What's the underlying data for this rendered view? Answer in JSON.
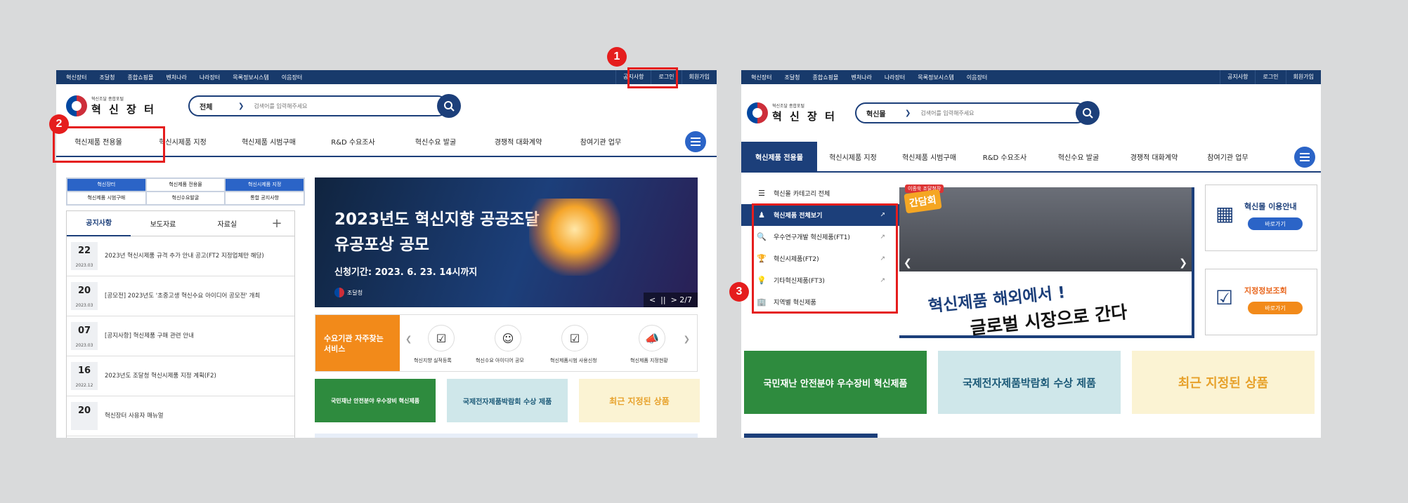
{
  "left": {
    "util_left": [
      "혁신장터",
      "조달청",
      "종합쇼핑몰",
      "벤처나라",
      "나라장터",
      "목록정보시스템",
      "이음장터"
    ],
    "util_right": [
      "공지사항",
      "로그인",
      "회원가입"
    ],
    "logo_small": "혁신조달 종합포털",
    "logo_big": "혁 신 장 터",
    "search_select": "전체",
    "search_placeholder": "검색어를 입력해주세요",
    "gnb": [
      "혁신제품 전용몰",
      "혁신시제품 지정",
      "혁신제품 시범구매",
      "R&D 수요조사",
      "혁신수요 발굴",
      "경쟁적 대화계약",
      "참여기관 업무"
    ],
    "tabgrid": [
      "혁신장터",
      "혁신제품 전용몰",
      "혁신시제품 지정",
      "혁신제품 시범구매",
      "혁신수요발굴",
      "통합 공지사항"
    ],
    "notice_tabs": [
      "공지사항",
      "보도자료",
      "자료실"
    ],
    "notice_plus": "+",
    "notices": [
      {
        "day": "22",
        "ym": "2023.03",
        "text": "2023년 혁신시제품 규격 추가 안내 공고(FT2 지정업체만 해당)"
      },
      {
        "day": "20",
        "ym": "2023.03",
        "text": "[공모전] 2023년도 '초중고생 혁신수요 아이디어 공모전' 개최"
      },
      {
        "day": "07",
        "ym": "2023.03",
        "text": "[공지사항] 혁신제품 구매 관련 안내"
      },
      {
        "day": "16",
        "ym": "2022.12",
        "text": "2023년도 조달청 혁신시제품 지정 계획(F2)"
      },
      {
        "day": "20",
        "ym": "",
        "text": "혁신장터 사용자 매뉴얼"
      }
    ],
    "banner_line1": "2023년도 혁신지향 공공조달",
    "banner_line2": "유공포상 공모",
    "banner_date": "신청기간: 2023. 6. 23. 14시까지",
    "banner_org": "조달청",
    "banner_page": "2/7",
    "service_label": "수요기관 자주찾는 서비스",
    "service_items": [
      "혁신지향 실적등록",
      "혁신수요 아이디어 공모",
      "혁신제품시범 사용신청",
      "혁신제품 지정현황"
    ],
    "promo1": "국민재난 안전분야 우수장비 혁신제품",
    "promo2": "국제전자제품박람회 수상 제품",
    "promo3": "최근 지정된 상품"
  },
  "right": {
    "util_left": [
      "혁신장터",
      "조달청",
      "종합쇼핑몰",
      "벤처나라",
      "나라장터",
      "목록정보시스템",
      "이음장터"
    ],
    "util_right": [
      "공지사항",
      "로그인",
      "회원가입"
    ],
    "logo_small": "혁신조달 종합포털",
    "logo_big": "혁 신 장 터",
    "search_select": "혁신몰",
    "search_placeholder": "검색어를 입력해주세요",
    "gnb": [
      "혁신제품 전용몰",
      "혁신시제품 지정",
      "혁신제품 시범구매",
      "R&D 수요조사",
      "혁신수요 발굴",
      "경쟁적 대화계약",
      "참여기관 업무"
    ],
    "categories": [
      {
        "label": "혁신몰 카테고리 전체",
        "icon": "☰"
      },
      {
        "label": "혁신제품 전체보기",
        "icon": "♟"
      },
      {
        "label": "우수연구개발 혁신제품(FT1)",
        "icon": "🔍"
      },
      {
        "label": "혁신시제품(FT2)",
        "icon": "🏆"
      },
      {
        "label": "기타혁신제품(FT3)",
        "icon": "💡"
      },
      {
        "label": "지역별 혁신제품",
        "icon": "🏢"
      }
    ],
    "banner_badge": "간담회",
    "banner_tag": "이종욱 조달청장",
    "banner_s1": "혁신제품 해외에서 !",
    "banner_s2": "글로벌 시장으로 간다",
    "side1_title": "혁신몰 이용안내",
    "side1_btn": "바로가기",
    "side2_title": "지정정보조회",
    "side2_btn": "바로가기",
    "promo1": "국민재난 안전분야 우수장비 혁신제품",
    "promo2": "국제전자제품박람회 수상 제품",
    "promo3": "최근 지정된 상품"
  },
  "markers": [
    "1",
    "2",
    "3"
  ],
  "colors": {
    "navy": "#183a6b",
    "accent": "#2b64c7",
    "highlight": "#e51d1d",
    "orange": "#f28a1a"
  }
}
